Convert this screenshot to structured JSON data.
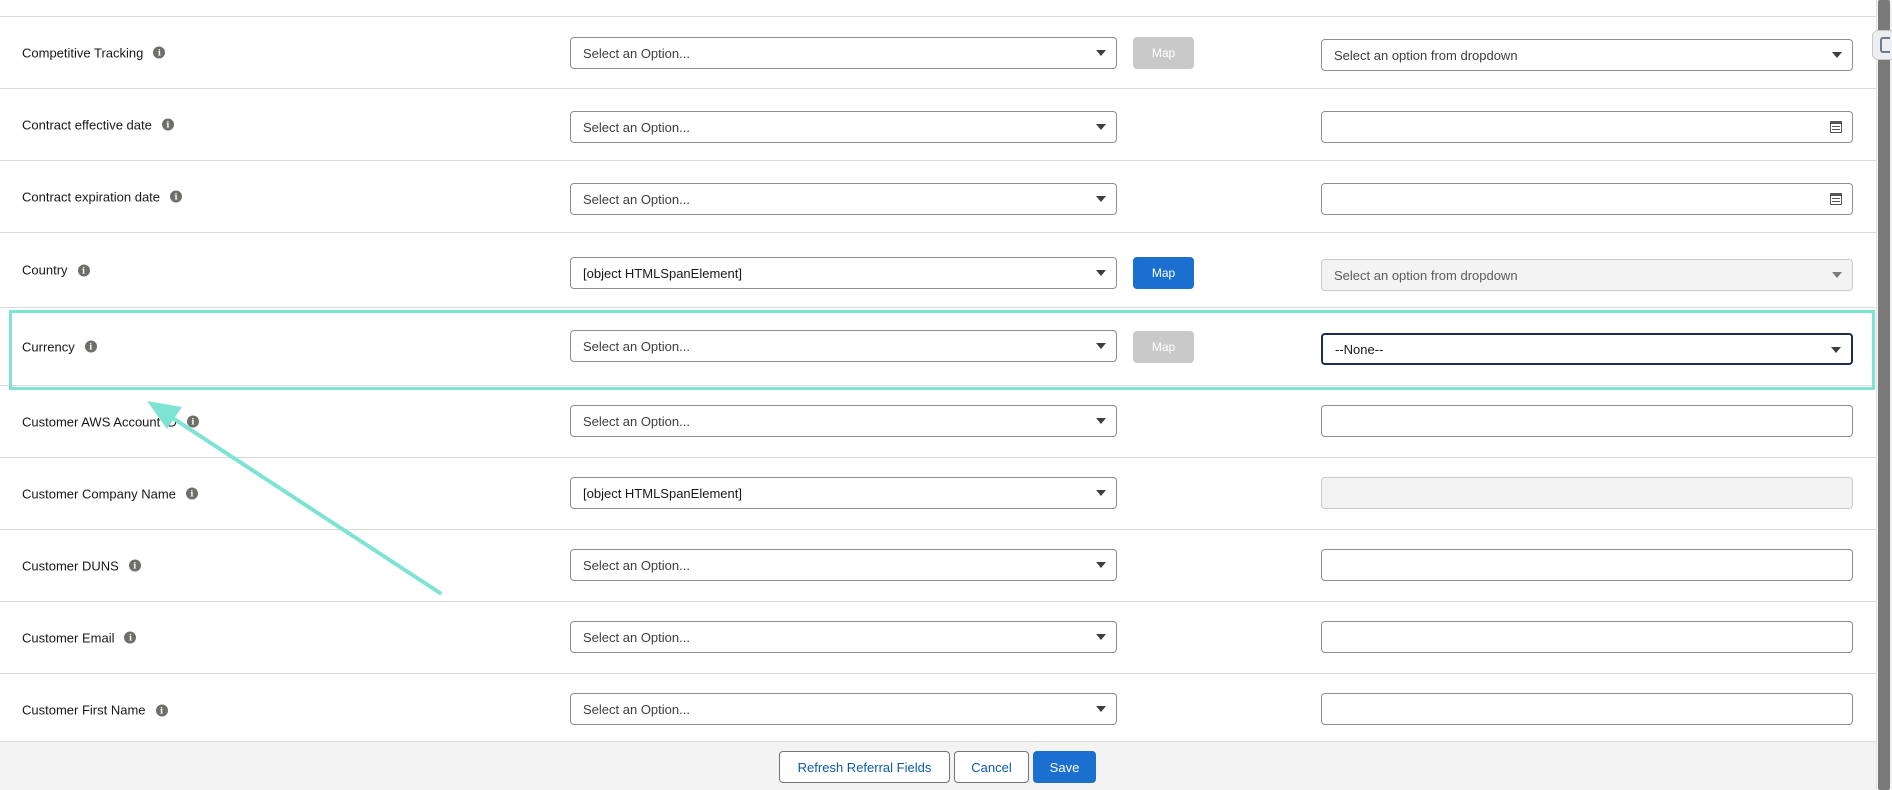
{
  "placeholders": {
    "select_option": "Select an Option...",
    "dropdown_option": "Select an option from dropdown"
  },
  "map_label": "Map",
  "rows": [
    {
      "label": "Competitive Tracking",
      "source": "Select an Option...",
      "map": "disabled",
      "target": "Select an option from dropdown",
      "target_type": "dropdown"
    },
    {
      "label": "Contract effective date",
      "source": "Select an Option...",
      "map": "none",
      "target": "",
      "target_type": "date"
    },
    {
      "label": "Contract expiration date",
      "source": "Select an Option...",
      "map": "none",
      "target": "",
      "target_type": "date"
    },
    {
      "label": "Country",
      "source": "[object HTMLSpanElement]",
      "map": "active",
      "target": "Select an option from dropdown",
      "target_type": "dropdown-disabled"
    },
    {
      "label": "Currency",
      "source": "Select an Option...",
      "map": "disabled",
      "target": "--None--",
      "target_type": "dropdown-focused"
    },
    {
      "label": "Customer AWS Account ID",
      "source": "Select an Option...",
      "map": "none",
      "target": "",
      "target_type": "text"
    },
    {
      "label": "Customer Company Name",
      "source": "[object HTMLSpanElement]",
      "map": "none",
      "target": "",
      "target_type": "text-disabled"
    },
    {
      "label": "Customer DUNS",
      "source": "Select an Option...",
      "map": "none",
      "target": "",
      "target_type": "text"
    },
    {
      "label": "Customer Email",
      "source": "Select an Option...",
      "map": "none",
      "target": "",
      "target_type": "text"
    },
    {
      "label": "Customer First Name",
      "source": "Select an Option...",
      "map": "none",
      "target": "",
      "target_type": "text"
    }
  ],
  "footer": {
    "refresh_label": "Refresh Referral Fields",
    "cancel_label": "Cancel",
    "save_label": "Save"
  },
  "colors": {
    "brand": "#1b6fce",
    "highlight": "#7fe3d4",
    "disabled_button": "#c9c9c9"
  }
}
